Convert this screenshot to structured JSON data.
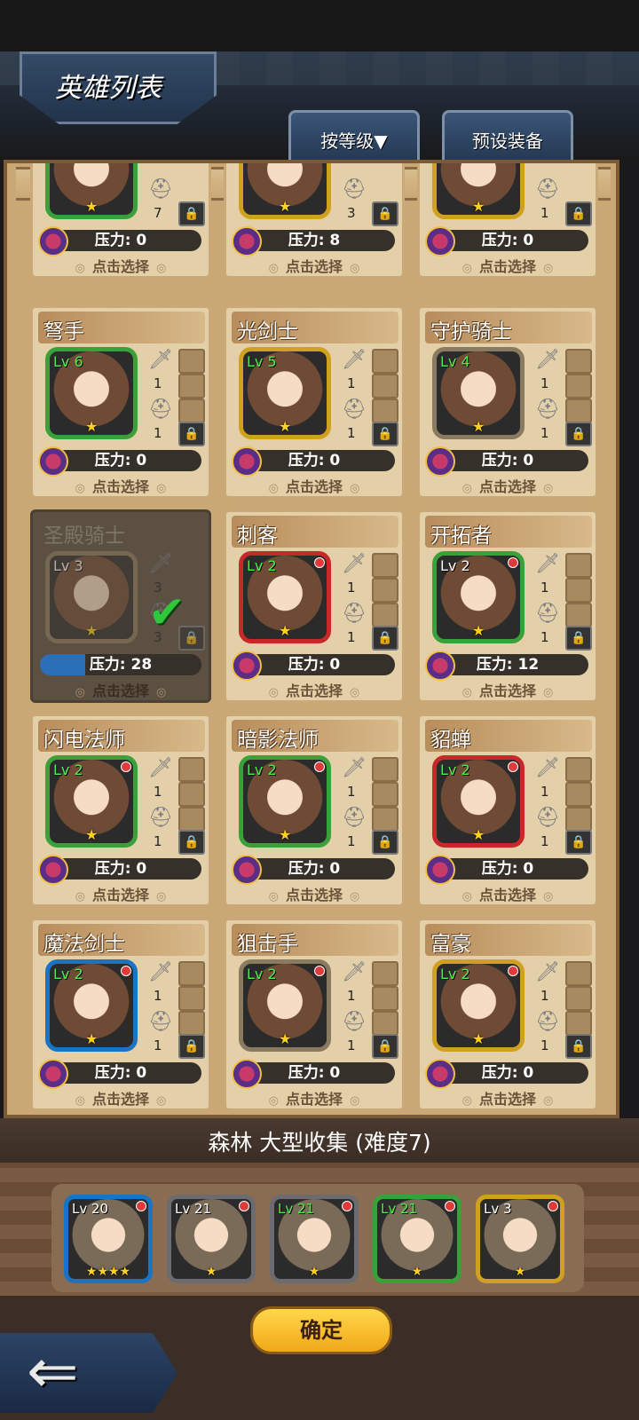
{
  "header": {
    "title": "英雄列表",
    "sort_label": "按等级▼",
    "preset_label": "预设装备"
  },
  "heroes_top_partial": [
    {
      "sword": "",
      "helm": "7",
      "pressure": "压力: 0",
      "select": "点击选择"
    },
    {
      "sword": "",
      "helm": "3",
      "pressure": "压力: 8",
      "select": "点击选择"
    },
    {
      "sword": "",
      "helm": "1",
      "pressure": "压力: 0",
      "select": "点击选择"
    }
  ],
  "heroes": [
    {
      "name": "弩手",
      "level": "Lv 6",
      "sword": "1",
      "helm": "1",
      "pressure": "压力: 0",
      "select": "点击选择"
    },
    {
      "name": "光剑士",
      "level": "Lv 5",
      "sword": "1",
      "helm": "1",
      "pressure": "压力: 0",
      "select": "点击选择"
    },
    {
      "name": "守护骑士",
      "level": "Lv 4",
      "sword": "1",
      "helm": "1",
      "pressure": "压力: 0",
      "select": "点击选择"
    },
    {
      "name": "圣殿骑士",
      "level": "Lv 3",
      "sword": "3",
      "helm": "3",
      "pressure": "压力: 28",
      "select": "点击选择"
    },
    {
      "name": "刺客",
      "level": "Lv 2",
      "sword": "1",
      "helm": "1",
      "pressure": "压力: 0",
      "select": "点击选择"
    },
    {
      "name": "开拓者",
      "level": "Lv 2",
      "sword": "1",
      "helm": "1",
      "pressure": "压力: 12",
      "select": "点击选择"
    },
    {
      "name": "闪电法师",
      "level": "Lv 2",
      "sword": "1",
      "helm": "1",
      "pressure": "压力: 0",
      "select": "点击选择"
    },
    {
      "name": "暗影法师",
      "level": "Lv 2",
      "sword": "1",
      "helm": "1",
      "pressure": "压力: 0",
      "select": "点击选择"
    },
    {
      "name": "貂蝉",
      "level": "Lv 2",
      "sword": "1",
      "helm": "1",
      "pressure": "压力: 0",
      "select": "点击选择"
    },
    {
      "name": "魔法剑士",
      "level": "Lv 2",
      "sword": "1",
      "helm": "1",
      "pressure": "压力: 0",
      "select": "点击选择"
    },
    {
      "name": "狙击手",
      "level": "Lv 2",
      "sword": "1",
      "helm": "1",
      "pressure": "压力: 0",
      "select": "点击选择"
    },
    {
      "name": "富豪",
      "level": "Lv 2",
      "sword": "1",
      "helm": "1",
      "pressure": "压力: 0",
      "select": "点击选择"
    }
  ],
  "mission": {
    "title": "森林 大型收集 (难度7)"
  },
  "team": [
    {
      "level": "Lv 20",
      "stars": "★★★★"
    },
    {
      "level": "Lv 21",
      "stars": "★"
    },
    {
      "level": "Lv 21",
      "stars": "★"
    },
    {
      "level": "Lv 21",
      "stars": "★"
    },
    {
      "level": "Lv 3",
      "stars": "★"
    }
  ],
  "confirm_label": "确定",
  "star": "★",
  "lock_glyph": "🔒"
}
